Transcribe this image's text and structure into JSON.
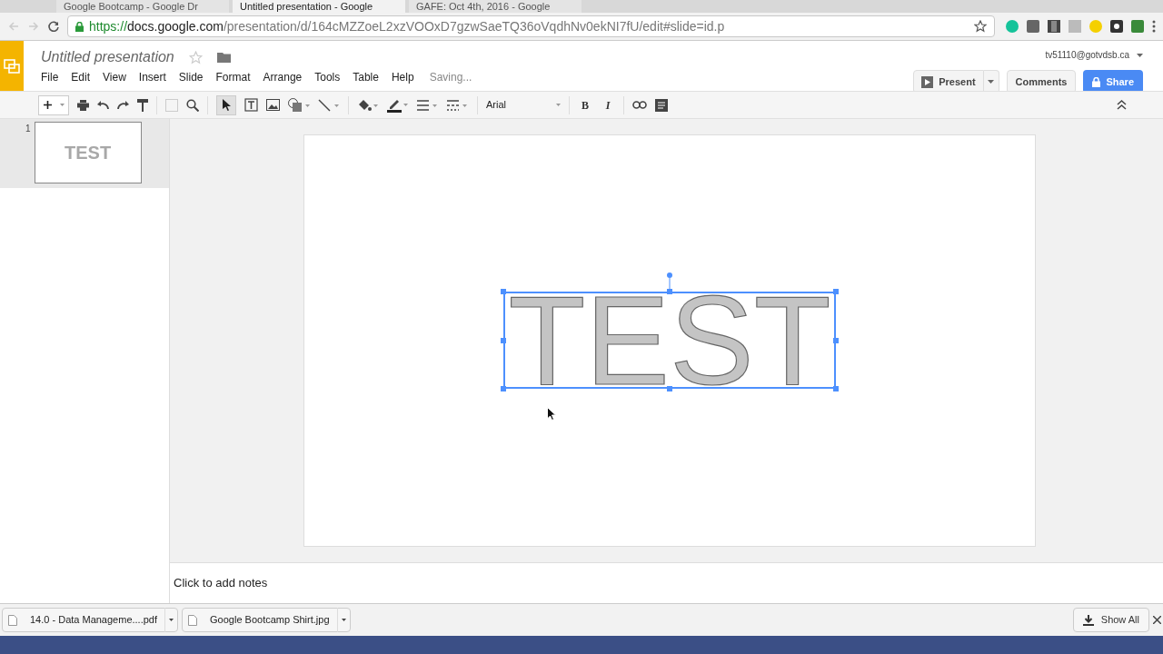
{
  "browser": {
    "tabs": [
      {
        "label": "Google Bootcamp - Google Dr",
        "selected": false
      },
      {
        "label": "Untitled presentation - Google",
        "selected": true
      },
      {
        "label": "GAFE: Oct 4th, 2016 - Google",
        "selected": false
      }
    ],
    "url_scheme": "https://",
    "url_host": "docs.google.com",
    "url_path": "/presentation/d/164cMZZoeL2xzVOOxD7gzwSaeTQ36oVqdhNv0ekNI7fU/edit#slide=id.p"
  },
  "app": {
    "title": "Untitled presentation",
    "account": "tv51110@gotvdsb.ca",
    "menus": [
      "File",
      "Edit",
      "View",
      "Insert",
      "Slide",
      "Format",
      "Arrange",
      "Tools",
      "Table",
      "Help"
    ],
    "status": "Saving...",
    "present": "Present",
    "comments": "Comments",
    "share": "Share"
  },
  "toolbar": {
    "font": "Arial",
    "bold": "B",
    "italic": "I"
  },
  "slides": [
    {
      "number": "1",
      "text": "TEST",
      "selected": true
    }
  ],
  "slide": {
    "text": "TEST"
  },
  "notes": {
    "placeholder": "Click to add notes"
  },
  "downloads": [
    {
      "name": "14.0 - Data Manageme....pdf"
    },
    {
      "name": "Google Bootcamp Shirt.jpg"
    }
  ],
  "show_all": "Show All"
}
